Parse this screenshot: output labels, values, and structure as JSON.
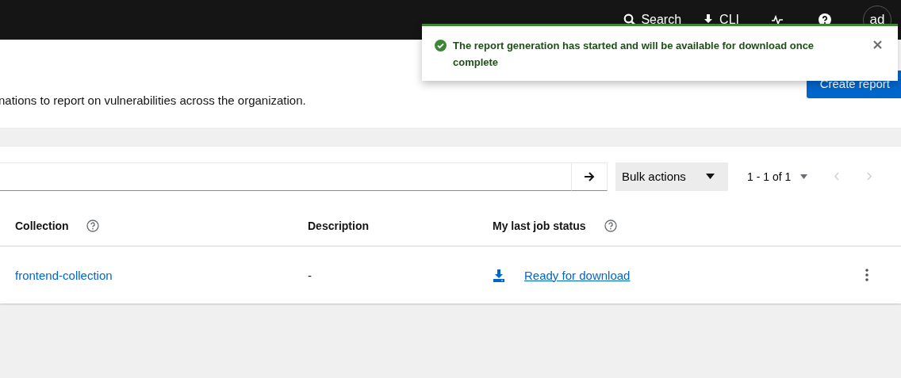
{
  "masthead": {
    "search": "Search",
    "cli": "CLI",
    "avatar": "ad"
  },
  "toast": {
    "message": "The report generation has started and will be available for download once complete"
  },
  "header": {
    "description": "nations to report on vulnerabilities across the organization.",
    "create_button": "Create report"
  },
  "toolbar": {
    "bulk_actions": "Bulk actions",
    "pagination": "1 - 1 of 1"
  },
  "table": {
    "columns": [
      {
        "label": "Collection",
        "help": true
      },
      {
        "label": "Description",
        "help": false
      },
      {
        "label": "My last job status",
        "help": true
      }
    ],
    "rows": [
      {
        "collection": "frontend-collection",
        "description": "-",
        "status": "Ready for download"
      }
    ]
  }
}
